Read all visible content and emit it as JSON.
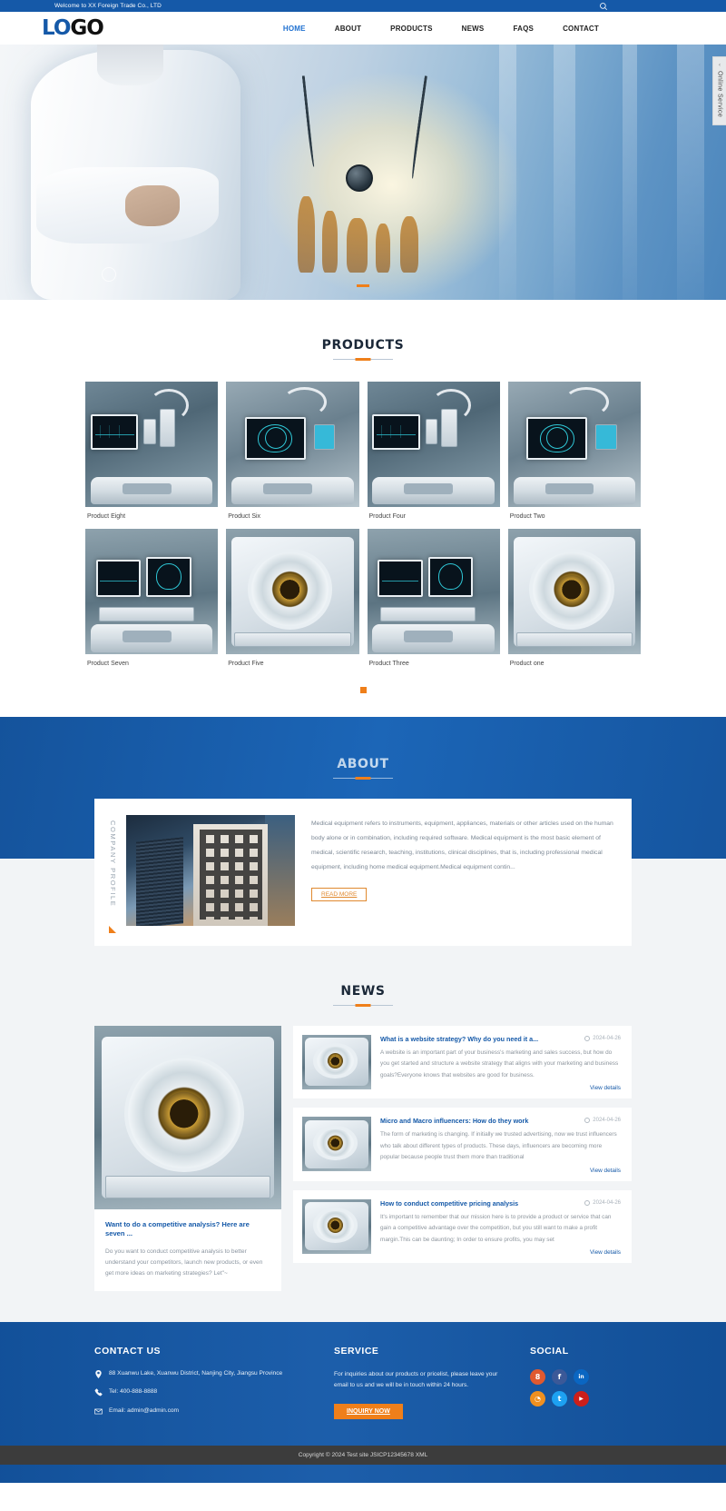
{
  "topbar": {
    "welcome": "Welcome to XX Foreign Trade Co., LTD",
    "search_icon": "search-icon"
  },
  "header": {
    "logo_part1": "LO",
    "logo_part2": "GO",
    "nav": [
      {
        "label": "HOME",
        "active": true
      },
      {
        "label": "ABOUT",
        "active": false
      },
      {
        "label": "PRODUCTS",
        "active": false
      },
      {
        "label": "NEWS",
        "active": false
      },
      {
        "label": "FAQS",
        "active": false
      },
      {
        "label": "CONTACT",
        "active": false
      }
    ]
  },
  "online_service": {
    "label": "Online Service",
    "arrow": "‹"
  },
  "hero": {
    "slides": 1,
    "active_dot": 0
  },
  "products": {
    "title": "PRODUCTS",
    "items": [
      {
        "name": "Product Eight"
      },
      {
        "name": "Product Six"
      },
      {
        "name": "Product Four"
      },
      {
        "name": "Product Two"
      },
      {
        "name": "Product Seven"
      },
      {
        "name": "Product Five"
      },
      {
        "name": "Product Three"
      },
      {
        "name": "Product one"
      }
    ]
  },
  "about": {
    "title": "ABOUT",
    "vertical_label": "COMPANY PROFILE",
    "paragraph": "Medical equipment refers to instruments, equipment, appliances, materials or other articles used on the human body alone or in combination, including required software. Medical equipment is the most basic element of medical, scientific research, teaching, institutions, clinical disciplines, that is, including professional medical equipment, including home medical equipment.Medical equipment contin...",
    "read_more": "READ MORE"
  },
  "news": {
    "title": "NEWS",
    "feature": {
      "title": "Want to do a competitive analysis? Here are seven ...",
      "desc": "Do you want to conduct competitive analysis to better understand your competitors, launch new products, or even get more ideas on marketing strategies? Let\"~"
    },
    "items": [
      {
        "title": "What is a website strategy? Why do you need it a...",
        "date": "2024-04-26",
        "desc": "A website is an important part of your business's marketing and sales success, but how do you get started and structure a website strategy that aligns with your marketing and business goals?Everyone knows that websites are good for business.",
        "more": "View details"
      },
      {
        "title": "Micro and Macro influencers: How do they work",
        "date": "2024-04-26",
        "desc": "The form of marketing is changing. If initially we trusted advertising, now we trust influencers who talk about different types of products. These days, influencers are becoming more popular because people trust them more than traditional",
        "more": "View details"
      },
      {
        "title": "How to conduct competitive pricing analysis",
        "date": "2024-04-26",
        "desc": "It's important to remember that our mission here is to provide a product or service that can gain a competitive advantage over the competition, but you still want to make a profit margin.This can be daunting; In order to ensure profits, you may set",
        "more": "View details"
      }
    ]
  },
  "footer": {
    "contact": {
      "heading": "CONTACT US",
      "address": "88 Xuanwu Lake, Xuanwu District, Nanjing City, Jiangsu Province",
      "tel": "Tel: 400-888-8888",
      "email": "Email: admin@admin.com"
    },
    "service": {
      "heading": "SERVICE",
      "text": "For inquiries about our products or pricelist, please leave your email to us and we will be in touch within 24 hours.",
      "button": "INQUIRY NOW"
    },
    "social": {
      "heading": "SOCIAL",
      "items": [
        {
          "name": "google-plus-icon",
          "glyph": "8",
          "color": "#e0592f"
        },
        {
          "name": "facebook-icon",
          "glyph": "f",
          "color": "#3b5998"
        },
        {
          "name": "linkedin-icon",
          "glyph": "in",
          "color": "#0a66c2"
        },
        {
          "name": "rss-icon",
          "glyph": "◔",
          "color": "#ef9020"
        },
        {
          "name": "twitter-icon",
          "glyph": "t",
          "color": "#1da1f2"
        },
        {
          "name": "youtube-icon",
          "glyph": "▶",
          "color": "#cc1f1a"
        }
      ]
    },
    "copyright": "Copyright © 2024 Test site JSICP12345678 XML"
  },
  "colors": {
    "brand_blue": "#1559a8",
    "accent_orange": "#ef7f1a",
    "link_blue": "#1d6fd0",
    "footer_dark": "#3c3c3c"
  }
}
